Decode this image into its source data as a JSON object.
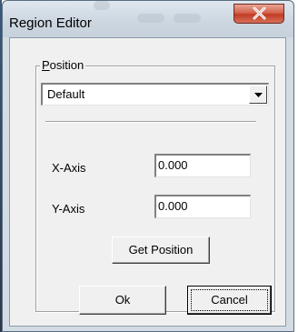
{
  "window": {
    "title": "Region Editor"
  },
  "position_group": {
    "label_prefix": "P",
    "label_rest": "osition",
    "selected_option": "Default"
  },
  "x_axis": {
    "label": "X-Axis",
    "value": "0.000"
  },
  "y_axis": {
    "label": "Y-Axis",
    "value": "0.000"
  },
  "buttons": {
    "get_position": "Get Position",
    "ok": "Ok",
    "cancel": "Cancel"
  },
  "icons": {
    "close": "close-icon",
    "dropdown": "chevron-down-icon"
  },
  "colors": {
    "close_button": "#c23b22",
    "dialog_face": "#f0f0f0",
    "frame": "#d3dbe4"
  }
}
